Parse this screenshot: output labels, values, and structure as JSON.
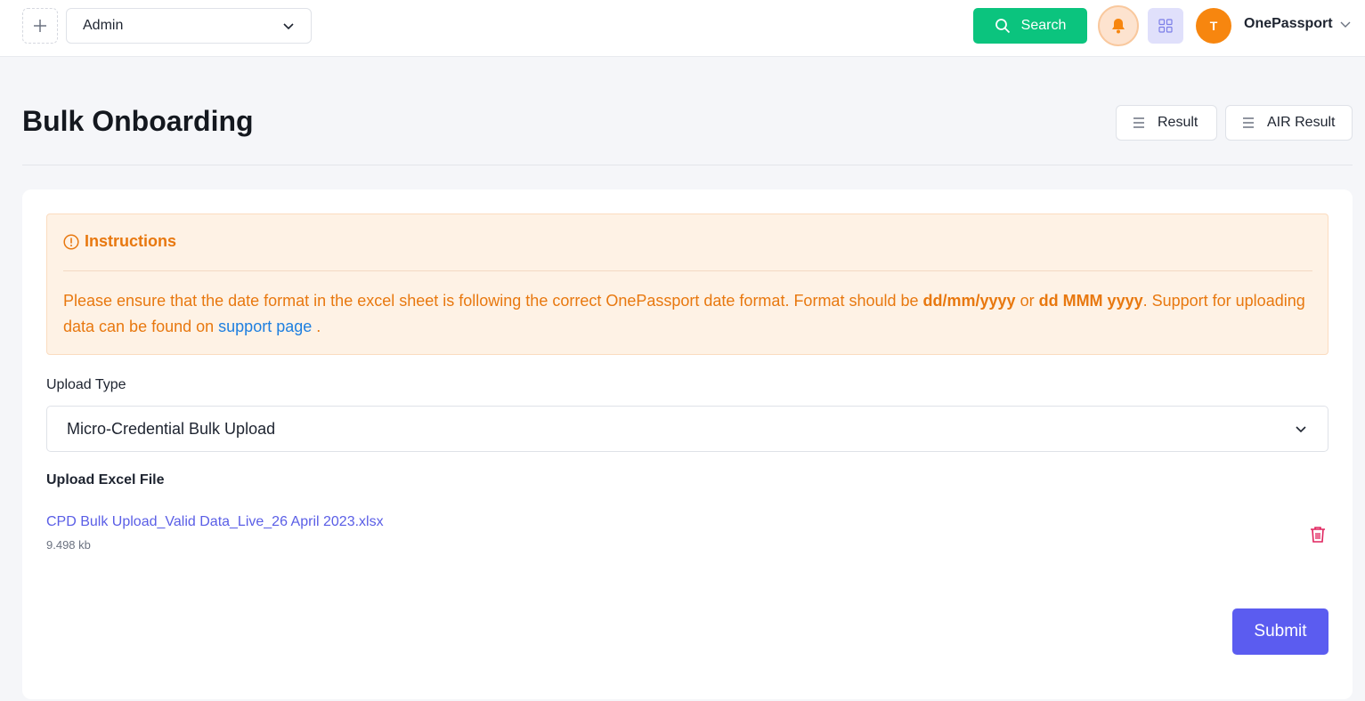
{
  "topbar": {
    "add_icon": "plus-icon",
    "role_select": {
      "value": "Admin"
    },
    "search_label": "Search",
    "bell_icon": "bell-icon",
    "apps_icon": "grid-icon",
    "avatar_initial": "T",
    "user_name": "OnePassport"
  },
  "page": {
    "title": "Bulk Onboarding",
    "result_label": "Result",
    "air_result_label": "AIR Result"
  },
  "instructions": {
    "title": "Instructions",
    "text_1": "Please ensure that the date format in the excel sheet is following the correct OnePassport date format. Format should be ",
    "format_1": "dd/mm/yyyy",
    "text_or": " or ",
    "format_2": "dd MMM yyyy",
    "text_2": ". Support for uploading data can be found on ",
    "link": "support page",
    "text_end": " ."
  },
  "form": {
    "upload_type_label": "Upload Type",
    "upload_type_value": "Micro-Credential Bulk Upload",
    "upload_file_label": "Upload Excel File",
    "file_name": "CPD Bulk Upload_Valid Data_Live_26 April 2023.xlsx",
    "file_size": "9.498 kb",
    "submit_label": "Submit"
  },
  "colors": {
    "search": "#0bc47e",
    "accent": "#5b5cf0",
    "warning": "#e8780f",
    "avatar": "#f7860f",
    "delete": "#e0245e"
  }
}
